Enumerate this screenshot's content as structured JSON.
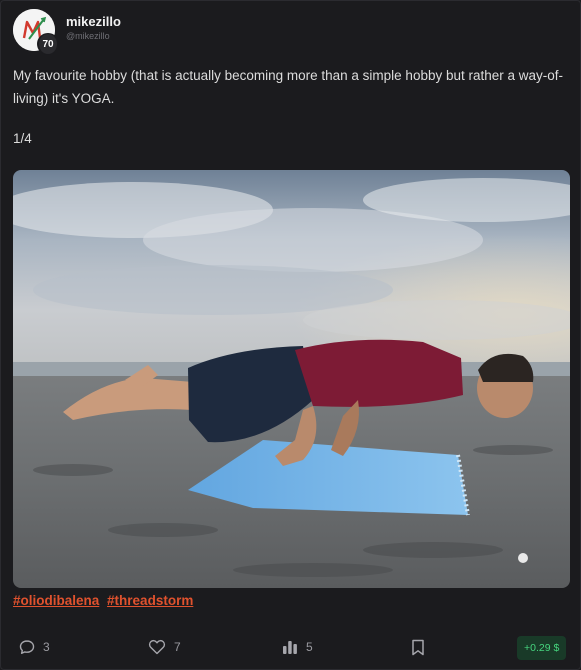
{
  "author": {
    "name": "mikezillo",
    "handle": "@mikezillo",
    "badge": "70",
    "avatar_letter": "M"
  },
  "post": {
    "text": "My favourite hobby (that is actually becoming more than a simple hobby but rather a way-of-living) it's YOGA.",
    "page_indicator": "1/4",
    "tags": [
      "#oliodibalena",
      "#threadstorm"
    ]
  },
  "actions": {
    "comments": "3",
    "likes": "7",
    "views": "5",
    "tip": "+0.29 $"
  },
  "colors": {
    "background": "#1c1c1f",
    "tag": "#e0522e",
    "tip_text": "#46d47e",
    "tip_bg": "#193a28"
  },
  "icons": [
    "comment-icon",
    "heart-icon",
    "bar-chart-icon",
    "bookmark-icon"
  ]
}
